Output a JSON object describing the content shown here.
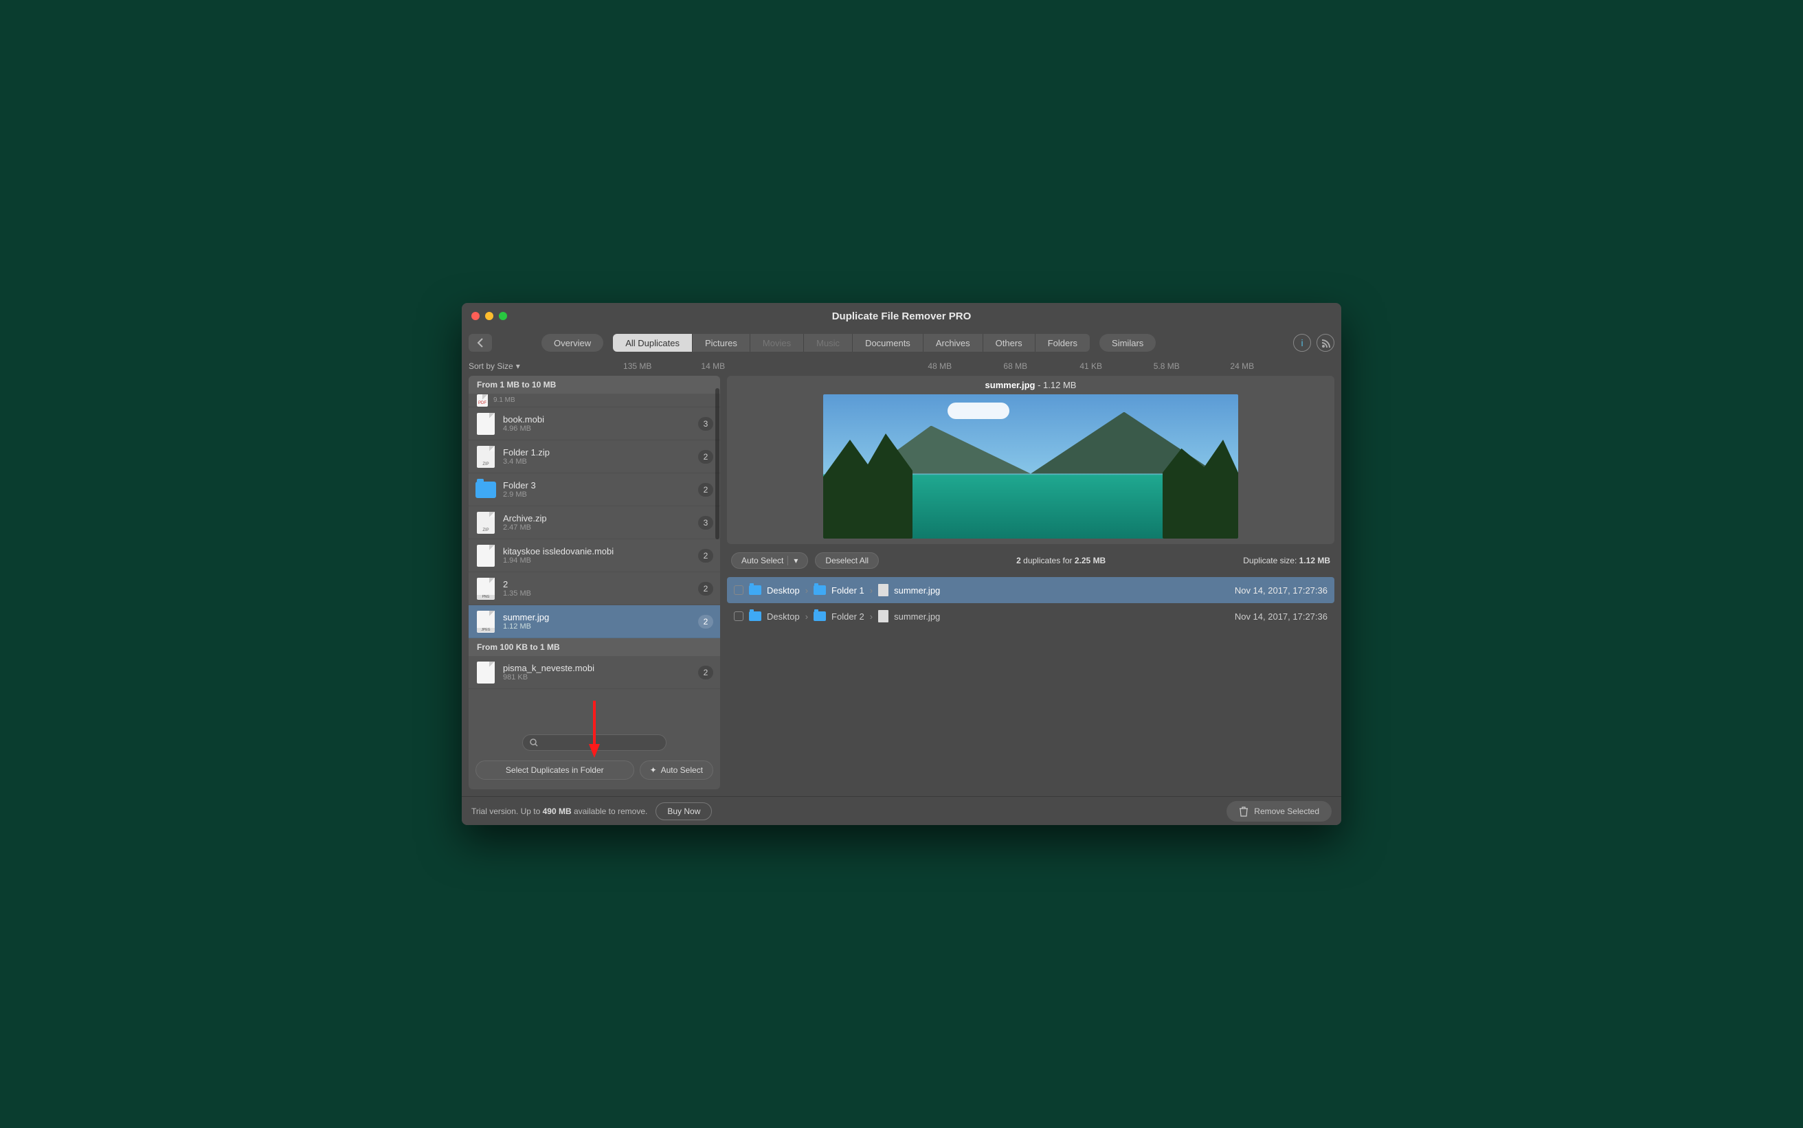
{
  "window": {
    "title": "Duplicate File Remover PRO"
  },
  "tabs": {
    "overview": "Overview",
    "all_duplicates": "All Duplicates",
    "pictures": "Pictures",
    "movies": "Movies",
    "music": "Music",
    "documents": "Documents",
    "archives": "Archives",
    "others": "Others",
    "folders": "Folders",
    "similars": "Similars"
  },
  "sort_label": "Sort by Size",
  "tab_sizes": {
    "all_duplicates": "135 MB",
    "pictures": "14 MB",
    "documents": "48 MB",
    "archives": "68 MB",
    "others": "41 KB",
    "folders": "5.8 MB",
    "similars": "24 MB"
  },
  "sections": [
    {
      "header": "From 1 MB to 10 MB",
      "items": [
        {
          "name": "",
          "size": "9.1 MB",
          "count": "",
          "icon": "pdf",
          "tiny": true
        },
        {
          "name": "book.mobi",
          "size": "4.96 MB",
          "count": "3",
          "icon": "file"
        },
        {
          "name": "Folder 1.zip",
          "size": "3.4 MB",
          "count": "2",
          "icon": "zip"
        },
        {
          "name": "Folder 3",
          "size": "2.9 MB",
          "count": "2",
          "icon": "folder"
        },
        {
          "name": "Archive.zip",
          "size": "2.47 MB",
          "count": "3",
          "icon": "zip"
        },
        {
          "name": "kitayskoe issledovanie.mobi",
          "size": "1.94 MB",
          "count": "2",
          "icon": "file"
        },
        {
          "name": "2",
          "size": "1.35 MB",
          "count": "2",
          "icon": "png"
        },
        {
          "name": "summer.jpg",
          "size": "1.12 MB",
          "count": "2",
          "icon": "jpeg",
          "selected": true
        }
      ]
    },
    {
      "header": "From 100 KB to 1 MB",
      "items": [
        {
          "name": "pisma_k_neveste.mobi",
          "size": "981 KB",
          "count": "2",
          "icon": "file"
        }
      ]
    }
  ],
  "left_buttons": {
    "select_in_folder": "Select Duplicates in Folder",
    "auto_select": "Auto Select"
  },
  "preview": {
    "filename": "summer.jpg",
    "size_label": " - 1.12 MB"
  },
  "dup_toolbar": {
    "auto_select": "Auto Select",
    "deselect_all": "Deselect All",
    "summary_pre": "2",
    "summary_mid": " duplicates for ",
    "summary_size": "2.25 MB",
    "dup_size_label": "Duplicate size: ",
    "dup_size_value": "1.12 MB"
  },
  "dup_rows": [
    {
      "path": [
        "Desktop",
        "Folder 1",
        "summer.jpg"
      ],
      "ts": "Nov 14, 2017, 17:27:36",
      "selected": true
    },
    {
      "path": [
        "Desktop",
        "Folder 2",
        "summer.jpg"
      ],
      "ts": "Nov 14, 2017, 17:27:36",
      "selected": false
    }
  ],
  "footer": {
    "trial_pre": "Trial version. Up to ",
    "trial_amount": "490 MB",
    "trial_post": " available to remove.",
    "buy_now": "Buy Now",
    "remove_selected": "Remove Selected"
  }
}
